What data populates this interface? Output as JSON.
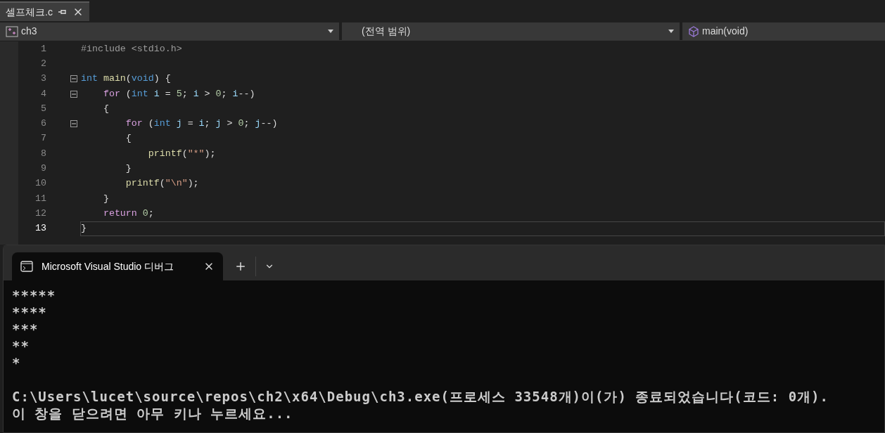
{
  "document_tab": {
    "title": "셀프체크.c",
    "selected": true
  },
  "nav_bar": {
    "project": "ch3",
    "scope": "(전역 범위)",
    "member": "main(void)"
  },
  "editor": {
    "lines": [
      {
        "number": "1",
        "foldable": false,
        "selected": false,
        "tokens": [
          {
            "kind": "preproc",
            "text": "#include <stdio.h>"
          }
        ]
      },
      {
        "number": "2",
        "foldable": false,
        "selected": false
      },
      {
        "number": "3",
        "foldable": true,
        "selected": false,
        "tokens": [
          {
            "kind": "keyword",
            "text": "int "
          },
          {
            "kind": "func",
            "text": "main"
          },
          {
            "kind": "plain",
            "text": "("
          },
          {
            "kind": "keyword",
            "text": "void"
          },
          {
            "kind": "plain",
            "text": ") {"
          }
        ]
      },
      {
        "number": "4",
        "foldable": true,
        "selected": false,
        "tokens": [
          {
            "kind": "control",
            "text": "    for"
          },
          {
            "kind": "plain",
            "text": " ("
          },
          {
            "kind": "keyword",
            "text": "int "
          },
          {
            "kind": "variable",
            "text": "i"
          },
          {
            "kind": "plain",
            "text": " = "
          },
          {
            "kind": "number",
            "text": "5"
          },
          {
            "kind": "plain",
            "text": "; "
          },
          {
            "kind": "variable",
            "text": "i"
          },
          {
            "kind": "plain",
            "text": " > "
          },
          {
            "kind": "number",
            "text": "0"
          },
          {
            "kind": "plain",
            "text": "; "
          },
          {
            "kind": "variable",
            "text": "i"
          },
          {
            "kind": "plain",
            "text": "--)"
          }
        ]
      },
      {
        "number": "5",
        "foldable": false,
        "selected": false,
        "tokens": [
          {
            "kind": "plain",
            "text": "    {"
          }
        ]
      },
      {
        "number": "6",
        "foldable": true,
        "selected": false,
        "tokens": [
          {
            "kind": "control",
            "text": "        for"
          },
          {
            "kind": "plain",
            "text": " ("
          },
          {
            "kind": "keyword",
            "text": "int "
          },
          {
            "kind": "variable",
            "text": "j"
          },
          {
            "kind": "plain",
            "text": " = "
          },
          {
            "kind": "variable",
            "text": "i"
          },
          {
            "kind": "plain",
            "text": "; "
          },
          {
            "kind": "variable",
            "text": "j"
          },
          {
            "kind": "plain",
            "text": " > "
          },
          {
            "kind": "number",
            "text": "0"
          },
          {
            "kind": "plain",
            "text": "; "
          },
          {
            "kind": "variable",
            "text": "j"
          },
          {
            "kind": "plain",
            "text": "--)"
          }
        ]
      },
      {
        "number": "7",
        "foldable": false,
        "selected": false,
        "tokens": [
          {
            "kind": "plain",
            "text": "        {"
          }
        ]
      },
      {
        "number": "8",
        "foldable": false,
        "selected": false,
        "tokens": [
          {
            "kind": "func",
            "text": "            printf"
          },
          {
            "kind": "plain",
            "text": "("
          },
          {
            "kind": "string",
            "text": "\"*\""
          },
          {
            "kind": "plain",
            "text": ");"
          }
        ]
      },
      {
        "number": "9",
        "foldable": false,
        "selected": false,
        "tokens": [
          {
            "kind": "plain",
            "text": "        }"
          }
        ]
      },
      {
        "number": "10",
        "foldable": false,
        "selected": false,
        "tokens": [
          {
            "kind": "func",
            "text": "        printf"
          },
          {
            "kind": "plain",
            "text": "("
          },
          {
            "kind": "string",
            "text": "\"\\n\""
          },
          {
            "kind": "plain",
            "text": ");"
          }
        ]
      },
      {
        "number": "11",
        "foldable": false,
        "selected": false,
        "tokens": [
          {
            "kind": "plain",
            "text": "    }"
          }
        ]
      },
      {
        "number": "12",
        "foldable": false,
        "selected": false,
        "tokens": [
          {
            "kind": "control",
            "text": "    return "
          },
          {
            "kind": "number",
            "text": "0"
          },
          {
            "kind": "plain",
            "text": ";"
          }
        ]
      },
      {
        "number": "13",
        "foldable": false,
        "selected": true,
        "tokens": [
          {
            "kind": "plain",
            "text": "}"
          }
        ]
      }
    ]
  },
  "console": {
    "tab_title": "Microsoft Visual Studio 디버그",
    "output": "*****\n****\n***\n**\n*",
    "exit_message": [
      "C:\\Users\\lucet\\source\\repos\\ch2\\x64\\Debug\\ch3.exe(프로세스 33548개)이(가) 종료되었습니다(코드: 0개).",
      "이 창을 닫으려면 아무 키나 누르세요..."
    ]
  }
}
